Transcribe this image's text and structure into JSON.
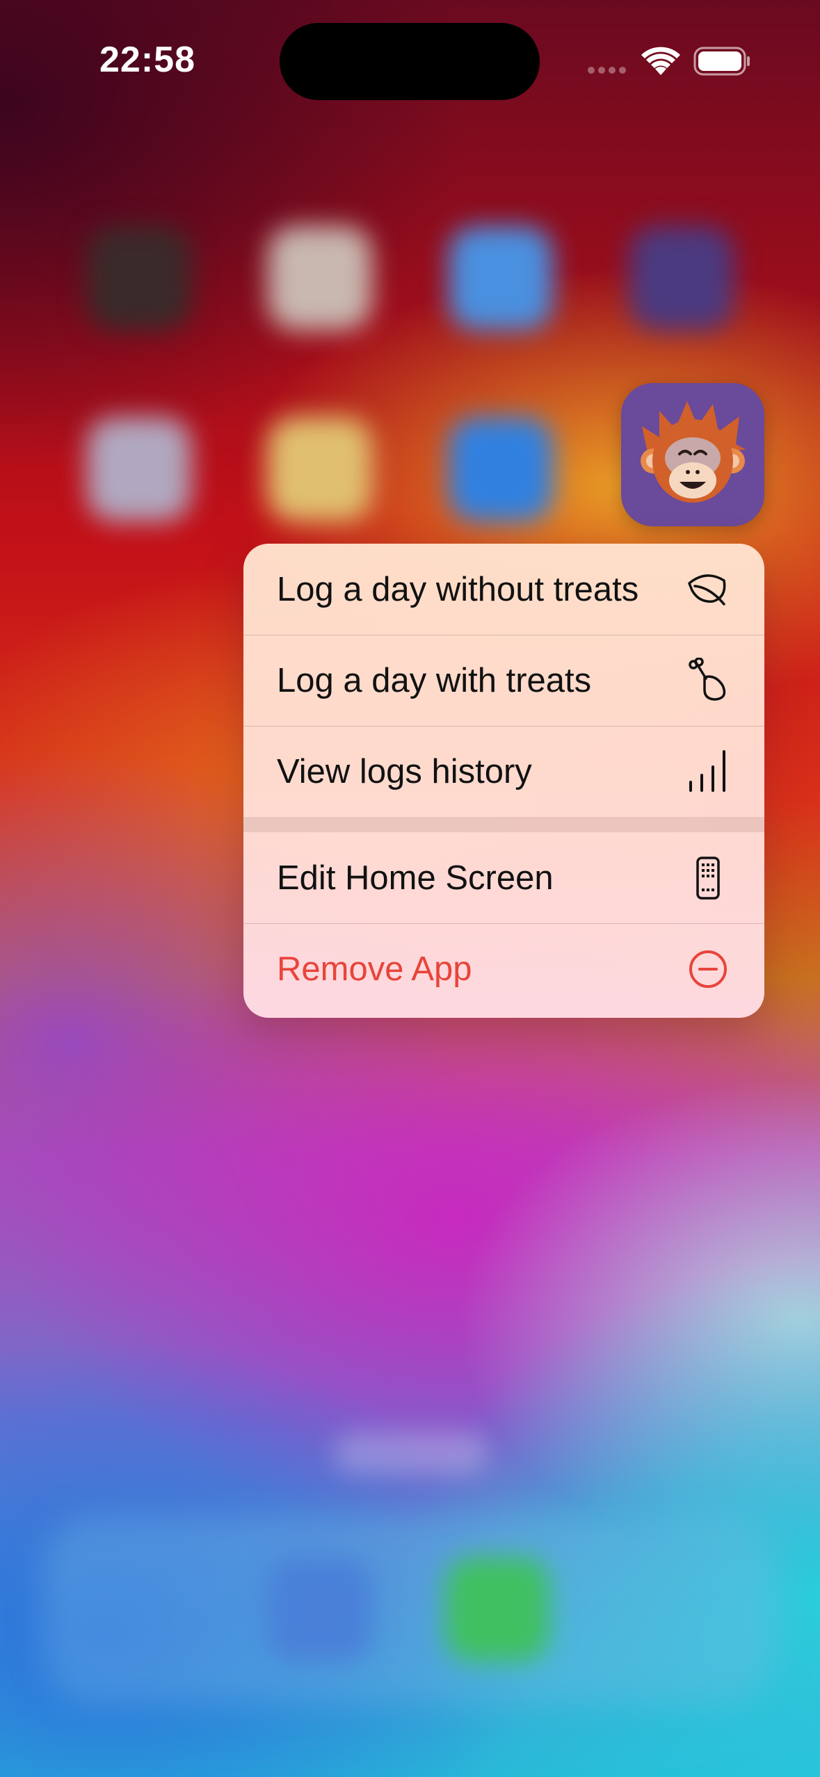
{
  "status_bar": {
    "time": "22:58",
    "signal_icon": "cellular-signal-icon",
    "wifi_icon": "wifi-icon",
    "battery_icon": "battery-icon"
  },
  "app": {
    "icon": "orangutan-app-icon",
    "colors": {
      "background": "#6a4a9a",
      "fur": "#d2602a"
    }
  },
  "context_menu": {
    "items": [
      {
        "label": "Log a day without treats",
        "icon": "leaf-icon"
      },
      {
        "label": "Log a day with treats",
        "icon": "drumstick-icon"
      },
      {
        "label": "View logs history",
        "icon": "chart-bars-icon"
      }
    ],
    "system_items": [
      {
        "label": "Edit Home Screen",
        "icon": "phone-apps-icon"
      },
      {
        "label": "Remove App",
        "icon": "minus-circle-icon",
        "color": "#e8443a"
      }
    ]
  }
}
